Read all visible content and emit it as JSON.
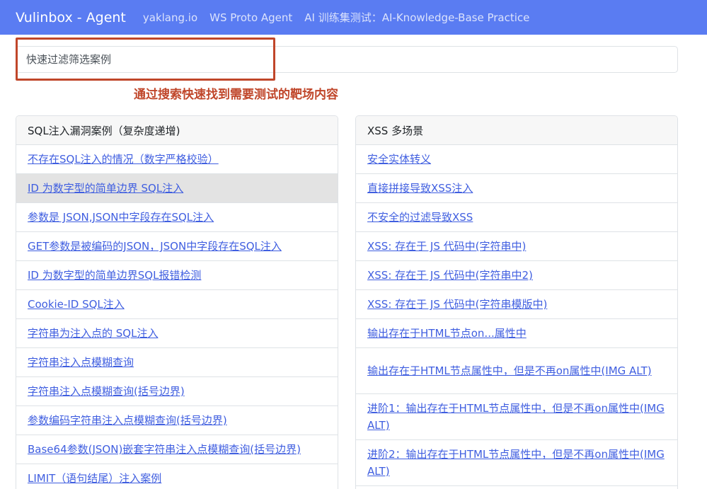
{
  "navbar": {
    "brand": "Vulinbox - Agent",
    "links": [
      "yaklang.io",
      "WS Proto Agent",
      "AI 训练集测试：AI-Knowledge-Base Practice"
    ]
  },
  "search": {
    "placeholder": "快速过滤筛选案例"
  },
  "annotation": {
    "text": "通过搜索快速找到需要测试的靶场内容",
    "color": "#c0462a"
  },
  "sql_panel": {
    "title": "SQL注入漏洞案例（复杂度递增)",
    "items": [
      "不存在SQL注入的情况（数字严格校验）",
      "ID 为数字型的简单边界 SQL注入",
      "参数是 JSON,JSON中字段存在SQL注入",
      "GET参数是被编码的JSON，JSON中字段存在SQL注入",
      "ID 为数字型的简单边界SQL报错检测",
      "Cookie-ID SQL注入",
      "字符串为注入点的 SQL注入",
      "字符串注入点模糊查询",
      "字符串注入点模糊查询(括号边界)",
      "参数编码字符串注入点模糊查询(括号边界)",
      "Base64参数(JSON)嵌套字符串注入点模糊查询(括号边界)",
      "LIMIT（语句结尾）注入案例"
    ]
  },
  "xss_panel": {
    "title": "XSS 多场景",
    "items": [
      "安全实体转义",
      "直接拼接导致XSS注入",
      "不安全的过滤导致XSS",
      "XSS: 存在于 JS 代码中(字符串中)",
      "XSS: 存在于 JS 代码中(字符串中2)",
      "XSS: 存在于 JS 代码中(字符串模版中)",
      "输出存在于HTML节点on...属性中",
      "输出存在于HTML节点属性中，但是不再on属性中(IMG ALT)",
      "进阶1：输出存在于HTML节点属性中，但是不再on属性中(IMG ALT)",
      "进阶2：输出存在于HTML节点属性中，但是不再on属性中(IMG ALT)"
    ]
  },
  "colors": {
    "navbar": "#5a7cf2",
    "link": "#3f5ee0",
    "active_row": "#e3e3e3"
  }
}
